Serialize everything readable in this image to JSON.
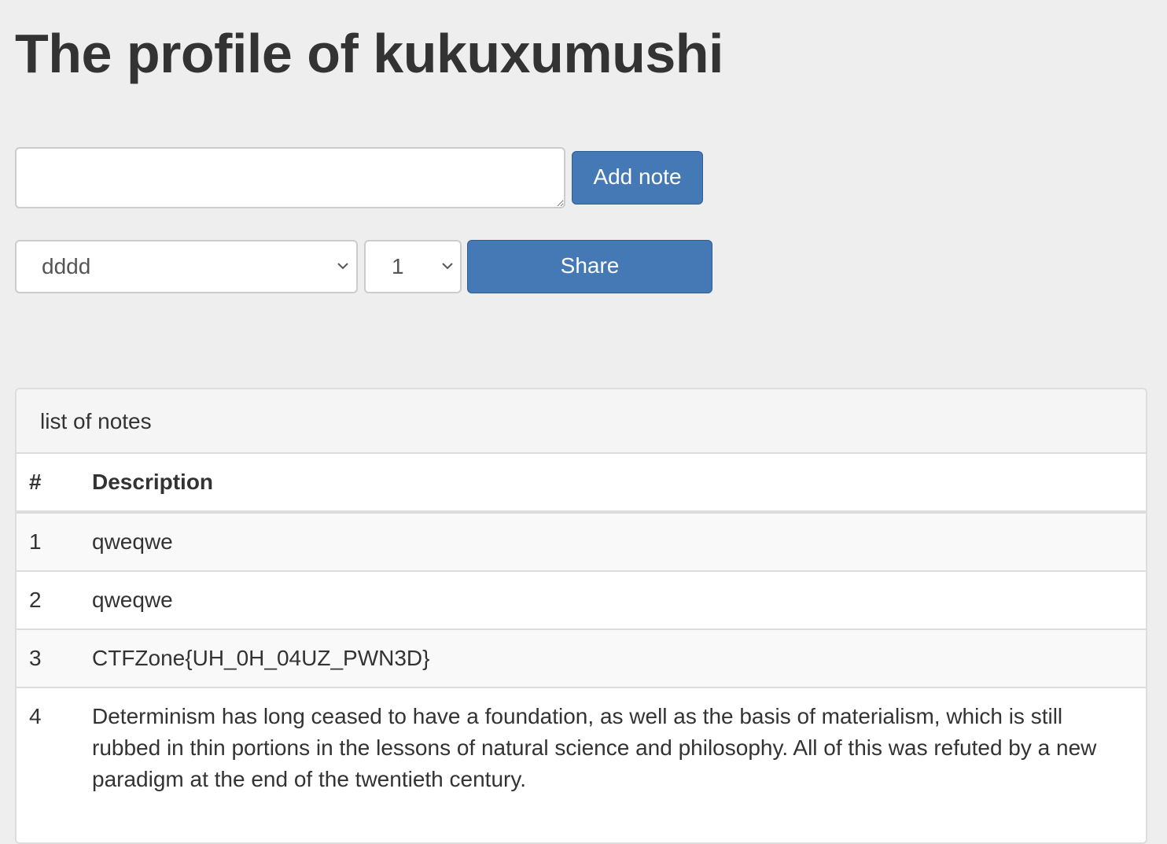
{
  "page": {
    "title": "The profile of kukuxumushi"
  },
  "note_form": {
    "textarea_value": "",
    "add_button_label": "Add note"
  },
  "share_form": {
    "user_select_value": "dddd",
    "number_select_value": "1",
    "share_button_label": "Share"
  },
  "notes_panel": {
    "heading": "list of notes",
    "columns": [
      "#",
      "Description"
    ],
    "rows": [
      {
        "num": "1",
        "description": "qweqwe"
      },
      {
        "num": "2",
        "description": "qweqwe"
      },
      {
        "num": "3",
        "description": "CTFZone{UH_0H_04UZ_PWN3D}"
      },
      {
        "num": "4",
        "description": "Determinism has long ceased to have a foundation, as well as the basis of materialism, which is still rubbed in thin portions in the lessons of natural science and philosophy. All of this was refuted by a new paradigm at the end of the twentieth century."
      }
    ]
  },
  "colors": {
    "background": "#eeeeee",
    "button_primary": "#4479b5",
    "text": "#333333",
    "border": "#dddddd"
  },
  "icons": {
    "select_arrow": "chevron-down-icon",
    "textarea_resize": "resize-handle-icon"
  }
}
